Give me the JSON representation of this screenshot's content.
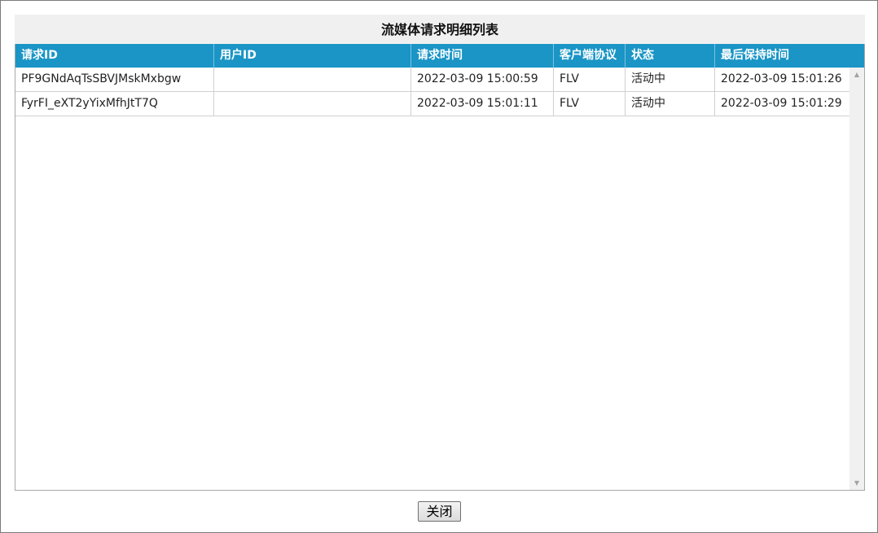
{
  "dialog": {
    "title": "流媒体请求明细列表",
    "close_label": "关闭"
  },
  "table": {
    "columns": [
      "请求ID",
      "用户ID",
      "请求时间",
      "客户端协议",
      "状态",
      "最后保持时间"
    ],
    "rows": [
      [
        "PF9GNdAqTsSBVJMskMxbgw",
        "",
        "2022-03-09 15:00:59",
        "FLV",
        "活动中",
        "2022-03-09 15:01:26"
      ],
      [
        "FyrFI_eXT2yYixMfhJtT7Q",
        "",
        "2022-03-09 15:01:11",
        "FLV",
        "活动中",
        "2022-03-09 15:01:29"
      ]
    ]
  },
  "icons": {
    "scroll_up": "scroll-up-arrow-icon",
    "scroll_down": "scroll-down-arrow-icon"
  },
  "colors": {
    "header_bg": "#1a95c6",
    "title_bg": "#f0f0f0"
  }
}
